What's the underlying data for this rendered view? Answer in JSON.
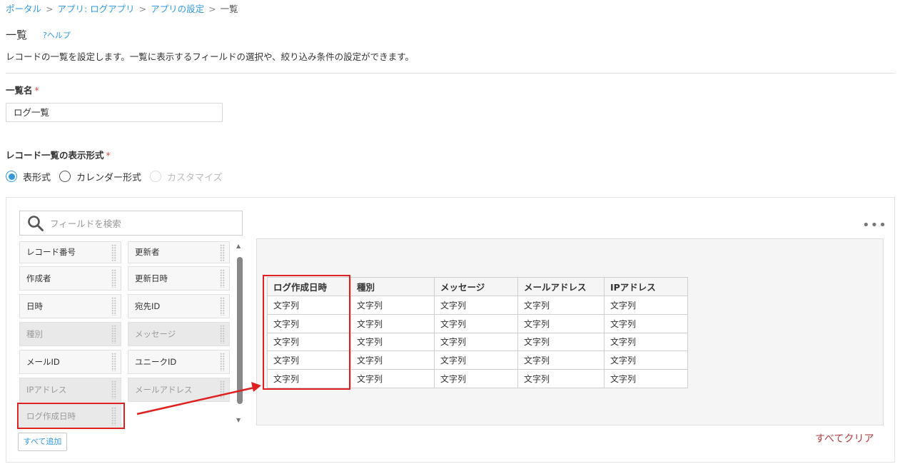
{
  "breadcrumb": {
    "items": [
      "ポータル",
      "アプリ: ログアプリ",
      "アプリの設定"
    ],
    "current": "一覧",
    "separator": ">"
  },
  "page": {
    "title": "一覧",
    "help": "?ヘルプ",
    "description": "レコードの一覧を設定します。一覧に表示するフィールドの選択や、絞り込み条件の設定ができます。"
  },
  "view_name": {
    "label": "一覧名",
    "required_mark": "*",
    "value": "ログ一覧"
  },
  "display_format": {
    "label": "レコード一覧の表示形式",
    "required_mark": "*",
    "options": [
      {
        "label": "表形式",
        "selected": true,
        "disabled": false
      },
      {
        "label": "カレンダー形式",
        "selected": false,
        "disabled": false
      },
      {
        "label": "カスタマイズ",
        "selected": false,
        "disabled": true
      }
    ]
  },
  "field_search": {
    "placeholder": "フィールドを検索"
  },
  "fields": [
    {
      "label": "レコード番号",
      "disabled": false
    },
    {
      "label": "更新者",
      "disabled": false
    },
    {
      "label": "作成者",
      "disabled": false
    },
    {
      "label": "更新日時",
      "disabled": false
    },
    {
      "label": "日時",
      "disabled": false
    },
    {
      "label": "宛先ID",
      "disabled": false
    },
    {
      "label": "種別",
      "disabled": true
    },
    {
      "label": "メッセージ",
      "disabled": true
    },
    {
      "label": "メールID",
      "disabled": false
    },
    {
      "label": "ユニークID",
      "disabled": false
    },
    {
      "label": "IPアドレス",
      "disabled": true
    },
    {
      "label": "メールアドレス",
      "disabled": true
    },
    {
      "label": "ログ作成日時",
      "disabled": true
    }
  ],
  "add_all": "すべて追加",
  "more_menu": "•••",
  "preview": {
    "columns": [
      "ログ作成日時",
      "種別",
      "メッセージ",
      "メールアドレス",
      "IPアドレス"
    ],
    "rows": [
      [
        "文字列",
        "文字列",
        "文字列",
        "文字列",
        "文字列"
      ],
      [
        "文字列",
        "文字列",
        "文字列",
        "文字列",
        "文字列"
      ],
      [
        "文字列",
        "文字列",
        "文字列",
        "文字列",
        "文字列"
      ],
      [
        "文字列",
        "文字列",
        "文字列",
        "文字列",
        "文字列"
      ],
      [
        "文字列",
        "文字列",
        "文字列",
        "文字列",
        "文字列"
      ]
    ]
  },
  "clear_all": "すべてクリア",
  "colors": {
    "link": "#3498db",
    "required": "#e74c3c",
    "annotation": "#e02020",
    "clear": "#b13c3c"
  }
}
